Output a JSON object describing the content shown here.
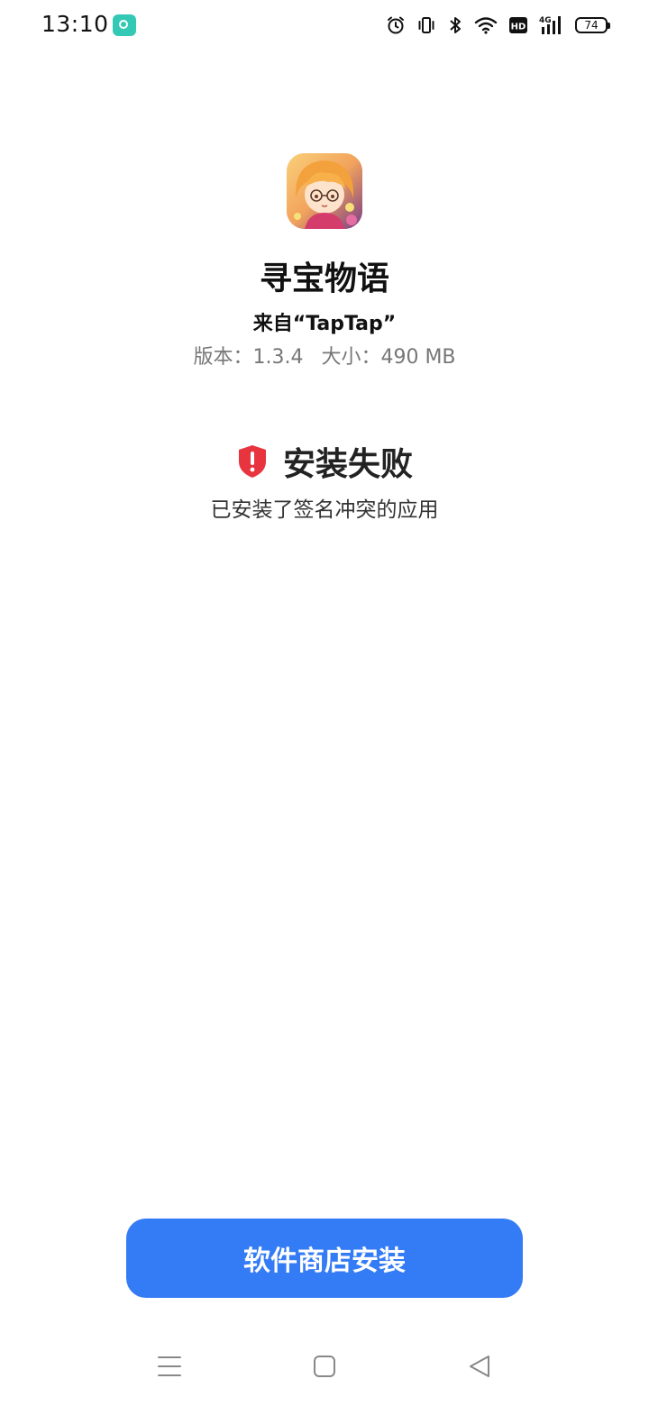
{
  "status_bar": {
    "time": "13:10",
    "battery_level": "74",
    "icons": [
      "app-notification-icon",
      "alarm-icon",
      "vibrate-icon",
      "bluetooth-icon",
      "wifi-icon",
      "hd-icon",
      "signal-4g-icon",
      "battery-icon"
    ],
    "hd_label": "HD",
    "network_label": "4G"
  },
  "app": {
    "name": "寻宝物语",
    "source": "来自“TapTap”",
    "version_label": "版本：1.3.4",
    "size_label": "大小：490 MB"
  },
  "status": {
    "title": "安装失败",
    "reason": "已安装了签名冲突的应用",
    "icon": "error-shield-icon",
    "color": "#e8343f"
  },
  "actions": {
    "store_install": "软件商店安装",
    "button_color": "#347bf6"
  },
  "nav": {
    "icons": [
      "menu-icon",
      "home-icon",
      "back-icon"
    ]
  }
}
